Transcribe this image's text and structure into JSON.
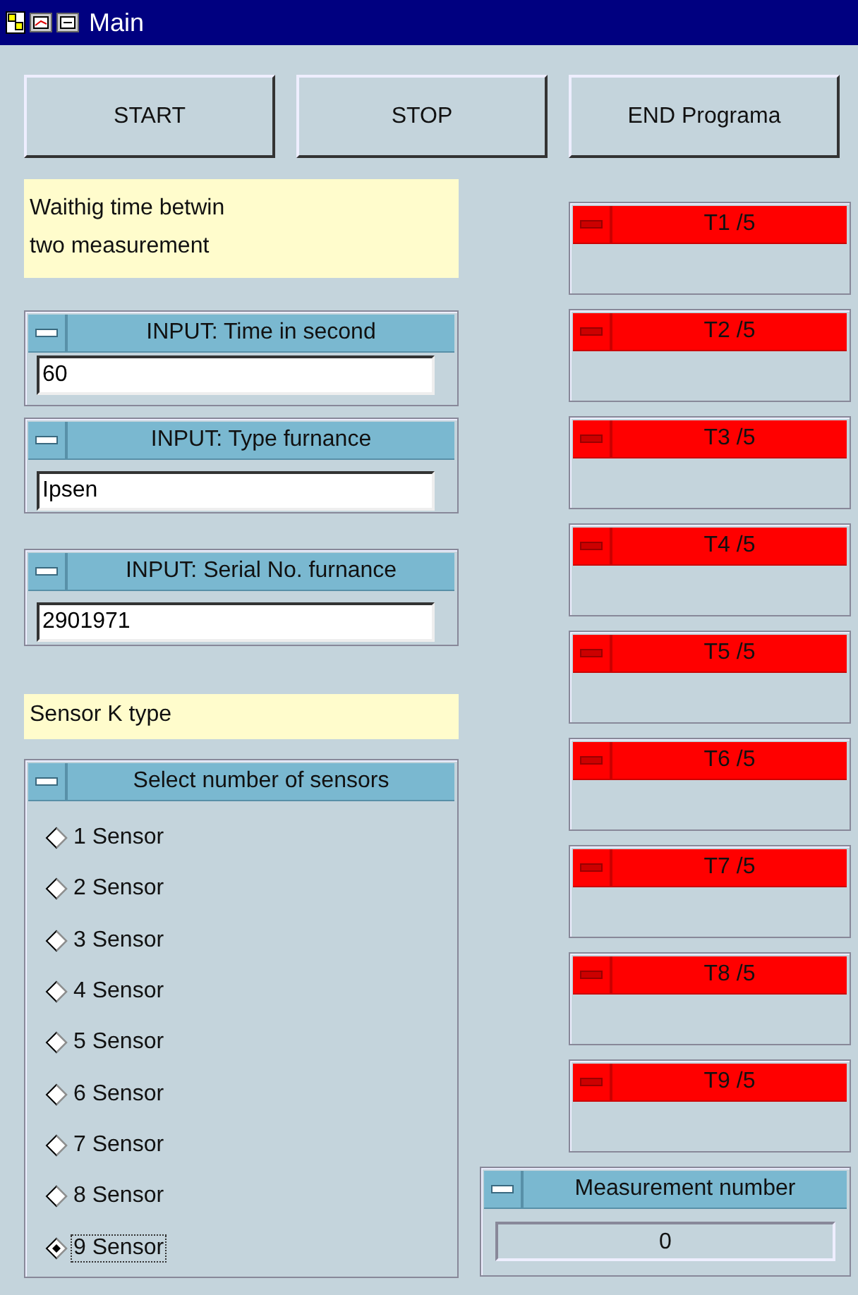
{
  "window": {
    "title": "Main"
  },
  "buttons": [
    "START",
    "STOP",
    "END Programa"
  ],
  "note": {
    "lines": [
      "Waithig time betwin",
      "two measurement"
    ]
  },
  "inputs": [
    {
      "title": "INPUT:  Time in second",
      "value": "60"
    },
    {
      "title": "INPUT:  Type furnance",
      "value": "Ipsen"
    },
    {
      "title": "INPUT: Serial No. furnance",
      "value": "2901971"
    }
  ],
  "sensor_note": "Sensor K type",
  "sensor_select": {
    "title": "Select number of sensors",
    "options": [
      {
        "label": "1 Sensor",
        "selected": false
      },
      {
        "label": "2 Sensor",
        "selected": false
      },
      {
        "label": "3 Sensor",
        "selected": false
      },
      {
        "label": "4 Sensor",
        "selected": false
      },
      {
        "label": "5 Sensor",
        "selected": false
      },
      {
        "label": "6 Sensor",
        "selected": false
      },
      {
        "label": "7 Sensor",
        "selected": false
      },
      {
        "label": "8 Sensor",
        "selected": false
      },
      {
        "label": "9 Sensor",
        "selected": true
      }
    ]
  },
  "temperatures": [
    {
      "title": "T1 /5"
    },
    {
      "title": "T2 /5"
    },
    {
      "title": "T3 /5"
    },
    {
      "title": "T4 /5"
    },
    {
      "title": "T5 /5"
    },
    {
      "title": "T6 /5"
    },
    {
      "title": "T7 /5"
    },
    {
      "title": "T8 /5"
    },
    {
      "title": "T9 /5"
    }
  ],
  "measurement": {
    "title": "Measurement number",
    "value": "0"
  }
}
